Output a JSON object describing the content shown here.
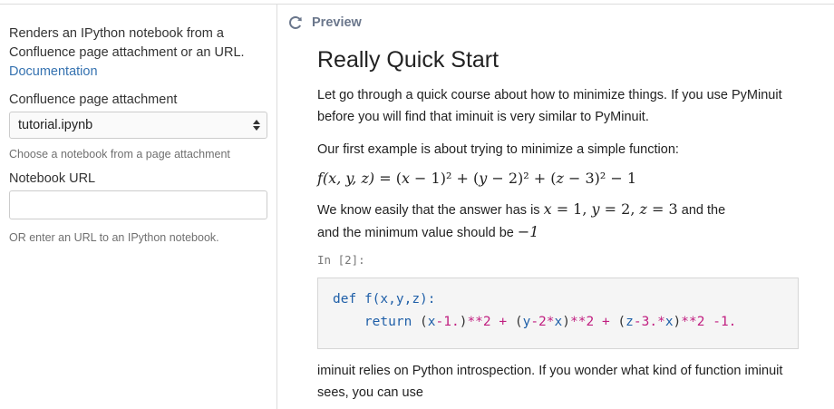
{
  "left_panel": {
    "description": "Renders an IPython notebook from a Confluence page attachment or an URL.",
    "documentation_link": "Documentation",
    "attachment_label": "Confluence page attachment",
    "attachment_selected": "tutorial.ipynb",
    "attachment_hint": "Choose a notebook from a page attachment",
    "url_label": "Notebook URL",
    "url_value": "",
    "url_hint": "OR enter an URL to an IPython notebook."
  },
  "preview": {
    "header_title": "Preview",
    "refresh_icon": "refresh-icon",
    "heading": "Really Quick Start",
    "para1": "Let go through a quick course about how to minimize things. If you use PyMinuit before you will find that iminuit is very similar to PyMinuit.",
    "para2": "Our first example is about trying to minimize a simple function:",
    "para3_before": "We know easily that the answer has is",
    "para3_middle": "and the minimum value should be",
    "in_prompt": "In [2]:",
    "code_line1_def": "def",
    "code_line1_sig": "f(x,y,z):",
    "code_line2_return": "return",
    "para4": "iminuit relies on Python introspection. If you wonder what kind of function iminuit sees, you can use"
  },
  "colors": {
    "link": "#3572b0",
    "code_keyword": "#1f5fa8",
    "code_number": "#c11f80",
    "code_background": "#f5f5f5"
  }
}
